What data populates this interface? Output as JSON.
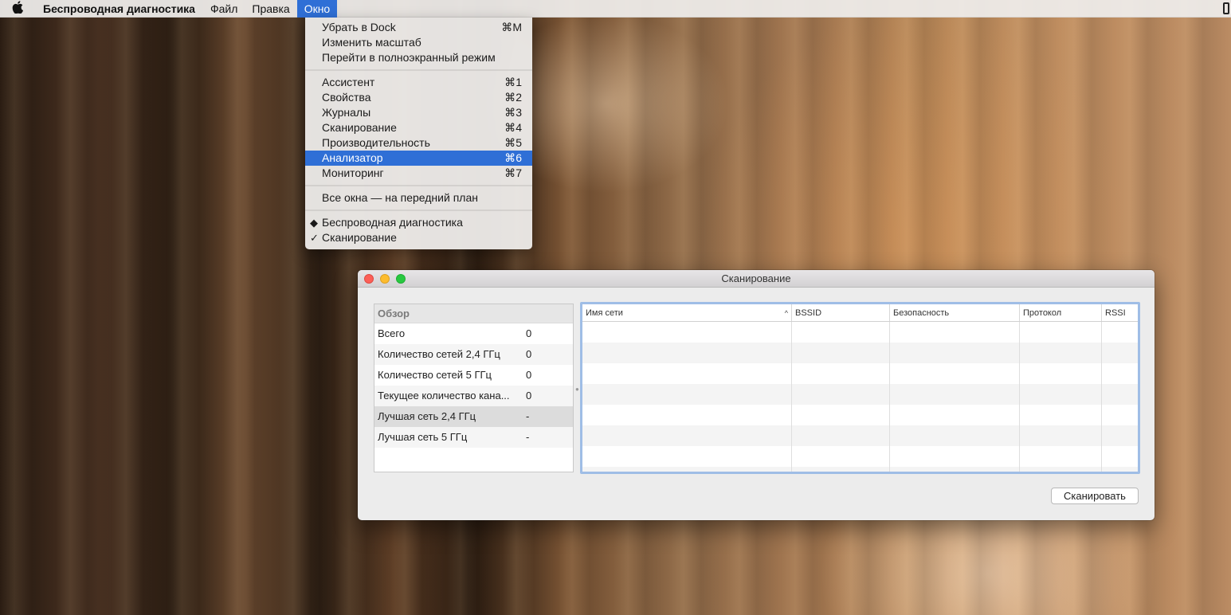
{
  "menubar": {
    "apple_icon": "apple-logo",
    "app_name": "Беспроводная диагностика",
    "items": [
      "Файл",
      "Правка",
      "Окно"
    ]
  },
  "window_menu": {
    "group1": [
      {
        "label": "Убрать в Dock",
        "shortcut": "⌘M"
      },
      {
        "label": "Изменить масштаб",
        "shortcut": ""
      },
      {
        "label": "Перейти в полноэкранный режим",
        "shortcut": ""
      }
    ],
    "group2": [
      {
        "label": "Ассистент",
        "shortcut": "⌘1"
      },
      {
        "label": "Свойства",
        "shortcut": "⌘2"
      },
      {
        "label": "Журналы",
        "shortcut": "⌘3"
      },
      {
        "label": "Сканирование",
        "shortcut": "⌘4"
      },
      {
        "label": "Производительность",
        "shortcut": "⌘5"
      },
      {
        "label": "Анализатор",
        "shortcut": "⌘6"
      },
      {
        "label": "Мониторинг",
        "shortcut": "⌘7"
      }
    ],
    "group3": [
      {
        "label": "Все окна — на передний план",
        "shortcut": ""
      }
    ],
    "group4": [
      {
        "label": "Беспроводная диагностика",
        "mark": "◆"
      },
      {
        "label": "Сканирование",
        "mark": "✓"
      }
    ],
    "highlighted": "Анализатор"
  },
  "scan_window": {
    "title": "Сканирование",
    "overview": {
      "header": "Обзор",
      "rows": [
        {
          "label": "Всего",
          "value": "0"
        },
        {
          "label": "Количество сетей 2,4 ГГц",
          "value": "0"
        },
        {
          "label": "Количество сетей 5 ГГц",
          "value": "0"
        },
        {
          "label": "Текущее количество кана...",
          "value": "0"
        },
        {
          "label": "Лучшая сеть 2,4 ГГц",
          "value": "-"
        },
        {
          "label": "Лучшая сеть 5 ГГц",
          "value": "-"
        }
      ]
    },
    "table": {
      "columns": [
        "Имя сети",
        "BSSID",
        "Безопасность",
        "Протокол",
        "RSSI"
      ],
      "sort_indicator": "^"
    },
    "scan_button": "Сканировать"
  },
  "colors": {
    "highlight": "#2f6fd6",
    "close": "#fc5f57",
    "minimize": "#fdbc2e",
    "zoom": "#28c840",
    "table_focus": "#9fbde6"
  }
}
